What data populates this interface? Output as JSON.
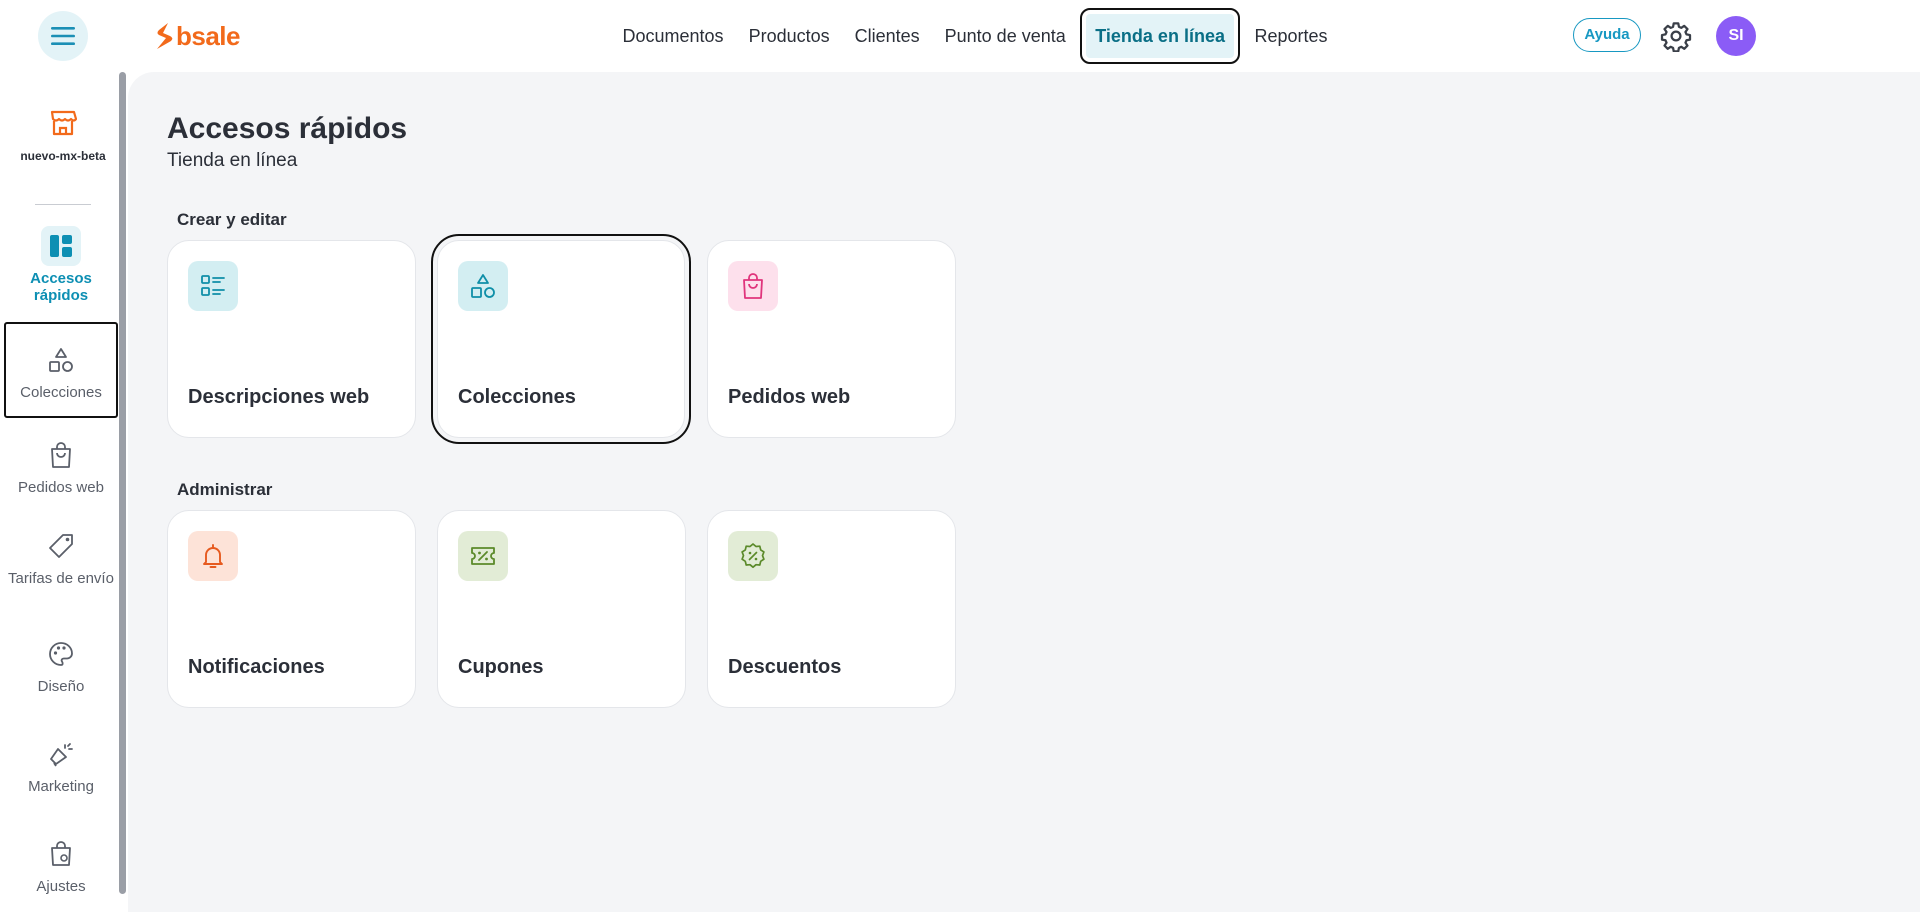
{
  "header": {
    "brand": "bsale",
    "nav": [
      {
        "label": "Documentos"
      },
      {
        "label": "Productos"
      },
      {
        "label": "Clientes"
      },
      {
        "label": "Punto de venta"
      },
      {
        "label": "Tienda en línea",
        "active": true
      },
      {
        "label": "Reportes"
      }
    ],
    "help_label": "Ayuda",
    "avatar_initials": "SI"
  },
  "sidebar": {
    "store_label": "nuevo-mx-beta",
    "items": [
      {
        "label": "Accesos rápidos",
        "icon": "grid-icon",
        "active": true
      },
      {
        "label": "Colecciones",
        "icon": "shapes-icon"
      },
      {
        "label": "Pedidos web",
        "icon": "shopping-bag-icon"
      },
      {
        "label": "Tarifas de envío",
        "icon": "tag-icon"
      },
      {
        "label": "Diseño",
        "icon": "palette-icon"
      },
      {
        "label": "Marketing",
        "icon": "megaphone-icon"
      },
      {
        "label": "Ajustes",
        "icon": "bag-settings-icon"
      }
    ]
  },
  "main": {
    "title": "Accesos rápidos",
    "subtitle": "Tienda en línea",
    "sections": [
      {
        "label": "Crear y editar",
        "cards": [
          {
            "label": "Descripciones web",
            "icon": "list-icon",
            "color": "#d3eef2"
          },
          {
            "label": "Colecciones",
            "icon": "shapes-icon",
            "color": "#d3eef2"
          },
          {
            "label": "Pedidos web",
            "icon": "shopping-bag-icon",
            "color": "#fde0ec"
          }
        ]
      },
      {
        "label": "Administrar",
        "cards": [
          {
            "label": "Notificaciones",
            "icon": "bell-icon",
            "color": "#fde3d8"
          },
          {
            "label": "Cupones",
            "icon": "coupon-icon",
            "color": "#e2ecd6"
          },
          {
            "label": "Descuentos",
            "icon": "discount-badge-icon",
            "color": "#e2ecd6"
          }
        ]
      }
    ]
  },
  "colors": {
    "brand_orange": "#f26a1b",
    "accent_teal": "#0d8fb3",
    "avatar_purple": "#8b5cf6",
    "background": "#f4f5f7"
  }
}
